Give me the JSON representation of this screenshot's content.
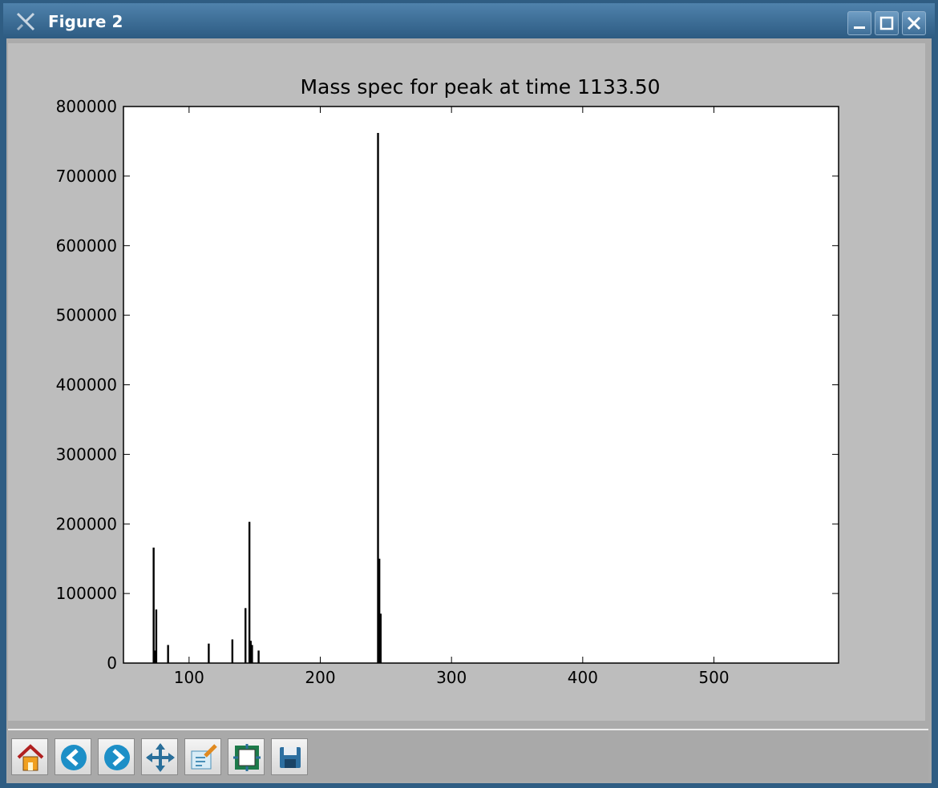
{
  "window": {
    "title": "Figure 2"
  },
  "toolbar": {
    "buttons": [
      {
        "name": "home-button",
        "icon": "home-icon"
      },
      {
        "name": "back-button",
        "icon": "back-arrow-icon"
      },
      {
        "name": "forward-button",
        "icon": "forward-arrow-icon"
      },
      {
        "name": "pan-button",
        "icon": "pan-icon"
      },
      {
        "name": "zoom-button",
        "icon": "zoom-rect-icon"
      },
      {
        "name": "subplots-button",
        "icon": "subplots-icon"
      },
      {
        "name": "save-button",
        "icon": "save-icon"
      }
    ]
  },
  "chart_data": {
    "type": "bar",
    "title": "Mass spec for peak at time 1133.50",
    "xlabel": "",
    "ylabel": "",
    "xlim": [
      50,
      595
    ],
    "ylim": [
      0,
      800000
    ],
    "xticks": [
      100,
      200,
      300,
      400,
      500
    ],
    "yticks": [
      0,
      100000,
      200000,
      300000,
      400000,
      500000,
      600000,
      700000,
      800000
    ],
    "grid": false,
    "bar_color": "#000000",
    "x": [
      73,
      74,
      75,
      84,
      115,
      133,
      143,
      146,
      147,
      148,
      153,
      244,
      245,
      246
    ],
    "values": [
      166000,
      18000,
      77000,
      26000,
      28000,
      34000,
      79000,
      203000,
      32000,
      26000,
      18000,
      762000,
      150000,
      71000
    ]
  }
}
